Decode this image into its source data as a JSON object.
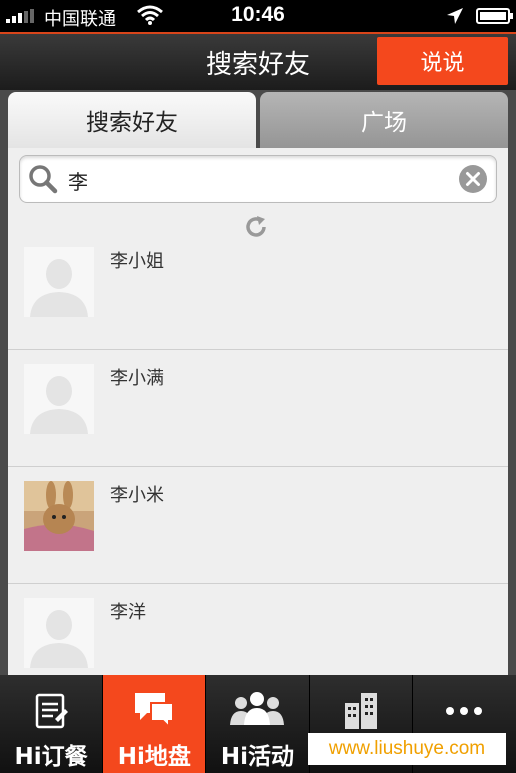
{
  "status_bar": {
    "carrier": "中国联通",
    "time": "10:46"
  },
  "nav": {
    "title": "搜索好友",
    "action_button": "说说"
  },
  "tabs": [
    {
      "label": "搜索好友",
      "active": true
    },
    {
      "label": "广场",
      "active": false
    }
  ],
  "search": {
    "value": "李"
  },
  "contacts": [
    {
      "name": "李小姐",
      "avatar": "default-avatar"
    },
    {
      "name": "李小满",
      "avatar": "default-avatar"
    },
    {
      "name": "李小米",
      "avatar": "photo-avatar"
    },
    {
      "name": "李洋",
      "avatar": "default-avatar"
    }
  ],
  "tab_bar": [
    {
      "label": "Hi订餐",
      "icon": "menu-list-icon",
      "active": false
    },
    {
      "label": "Hi地盘",
      "icon": "chat-bubbles-icon",
      "active": true
    },
    {
      "label": "Hi活动",
      "icon": "people-group-icon",
      "active": false
    },
    {
      "label": "",
      "icon": "buildings-icon",
      "active": false
    },
    {
      "label": "",
      "icon": "more-icon",
      "active": false
    }
  ],
  "watermark": "www.liushuye.com",
  "colors": {
    "accent": "#f4481d",
    "watermark_text": "#f0a000"
  }
}
